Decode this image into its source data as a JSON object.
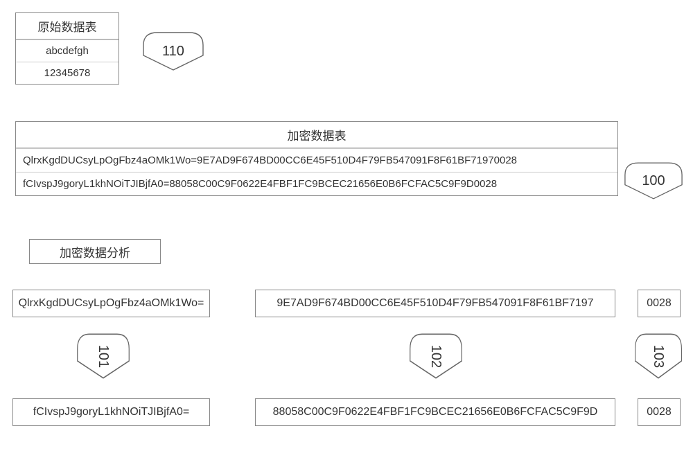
{
  "original": {
    "title": "原始数据表",
    "rows": [
      "abcdefgh",
      "12345678"
    ],
    "callout": "110"
  },
  "encrypted": {
    "title": "加密数据表",
    "rows": [
      "QlrxKgdDUCsyLpOgFbz4aOMk1Wo=9E7AD9F674BD00CC6E45F510D4F79FB547091F8F61BF71970028",
      "fCIvspJ9goryL1khNOiTJIBjfA0=88058C00C9F0622E4FBF1FC9BCEC21656E0B6FCFAC5C9F9D0028"
    ],
    "callout": "100"
  },
  "analysis": {
    "title": "加密数据分析",
    "col1": {
      "top": "QlrxKgdDUCsyLpOgFbz4aOMk1Wo=",
      "bottom": "fCIvspJ9goryL1khNOiTJIBjfA0=",
      "callout": "101"
    },
    "col2": {
      "top": "9E7AD9F674BD00CC6E45F510D4F79FB547091F8F61BF7197",
      "bottom": "88058C00C9F0622E4FBF1FC9BCEC21656E0B6FCFAC5C9F9D",
      "callout": "102"
    },
    "col3": {
      "top": "0028",
      "bottom": "0028",
      "callout": "103"
    }
  }
}
